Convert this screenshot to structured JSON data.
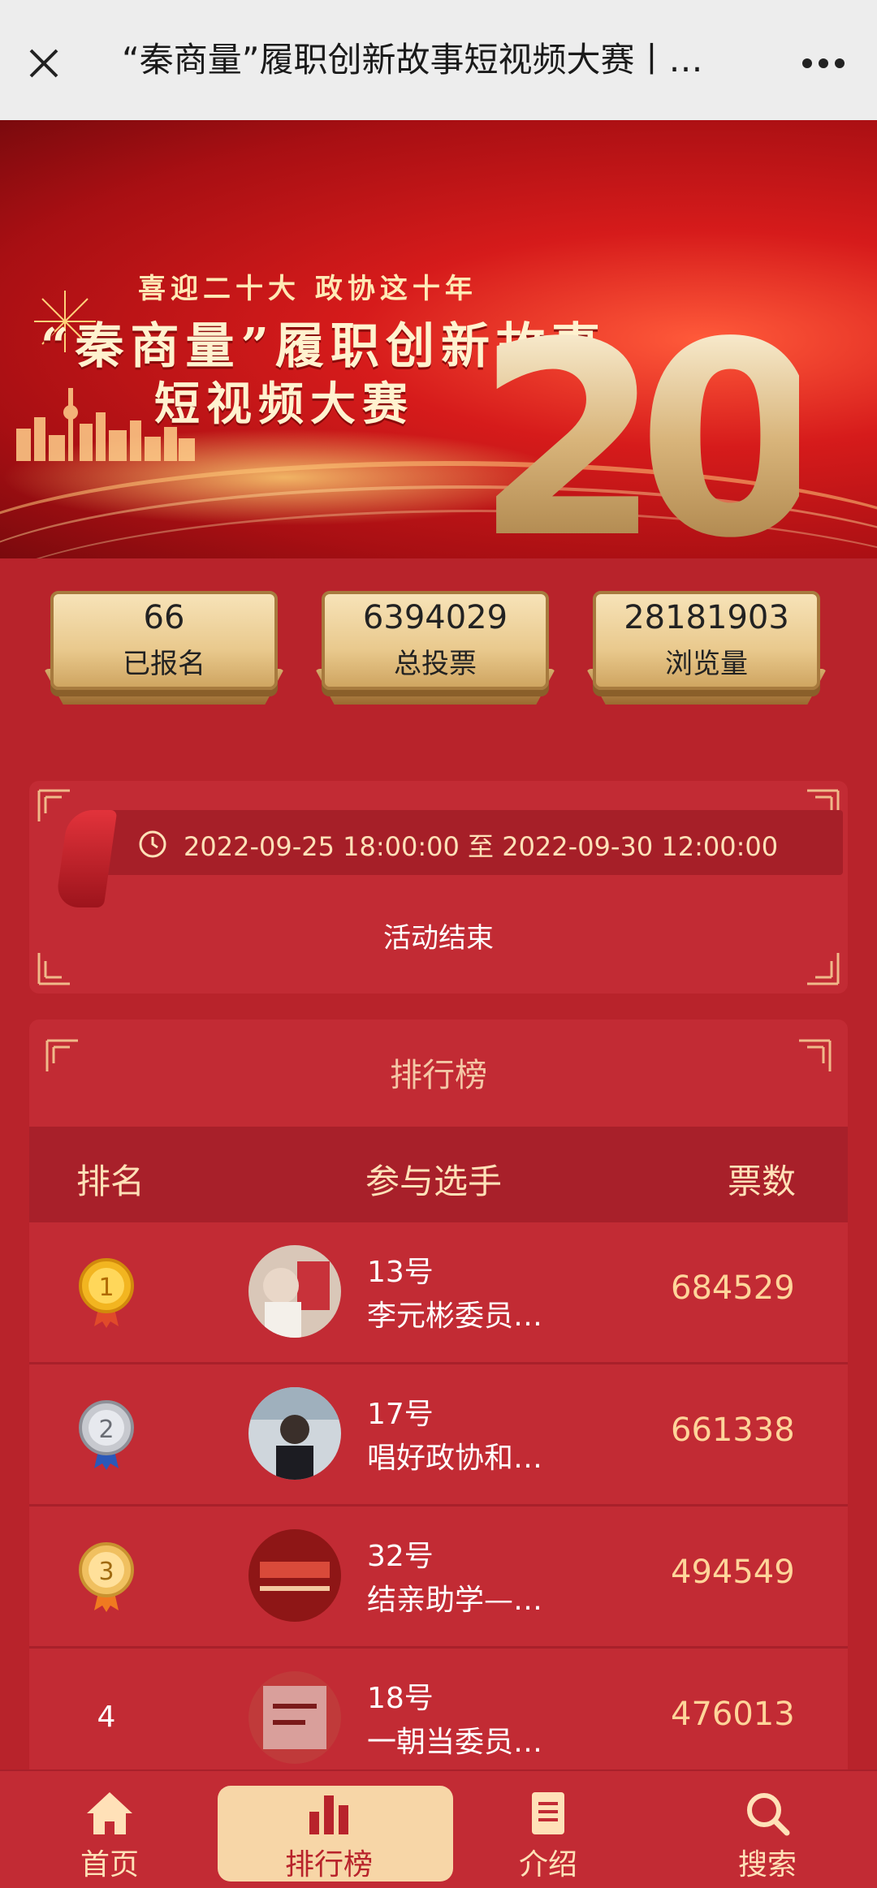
{
  "topbar": {
    "title": "“秦商量”履职创新故事短视频大赛丨…"
  },
  "banner": {
    "line1": "喜迎二十大 政协这十年",
    "line2": "“秦商量”履职创新故事",
    "line3": "短视频大赛",
    "big_number": "20"
  },
  "stats": [
    {
      "value": "66",
      "label": "已报名"
    },
    {
      "value": "6394029",
      "label": "总投票"
    },
    {
      "value": "28181903",
      "label": "浏览量"
    }
  ],
  "time_panel": {
    "range": "2022-09-25 18:00:00 至 2022-09-30 12:00:00",
    "status": "活动结束"
  },
  "ranking": {
    "title": "排行榜",
    "headers": {
      "rank": "排名",
      "player": "参与选手",
      "votes": "票数"
    },
    "rows": [
      {
        "rank": "1",
        "number": "13号",
        "name": "李元彬委员…",
        "votes": "684529",
        "medal": "gold"
      },
      {
        "rank": "2",
        "number": "17号",
        "name": "唱好政协和…",
        "votes": "661338",
        "medal": "silver"
      },
      {
        "rank": "3",
        "number": "32号",
        "name": "结亲助学—…",
        "votes": "494549",
        "medal": "bronze"
      },
      {
        "rank": "4",
        "number": "18号",
        "name": "一朝当委员…",
        "votes": "476013",
        "medal": "none"
      }
    ]
  },
  "bottom_nav": [
    {
      "label": "首页",
      "icon": "home-icon"
    },
    {
      "label": "排行榜",
      "icon": "bar-chart-icon",
      "active": true
    },
    {
      "label": "介绍",
      "icon": "document-icon"
    },
    {
      "label": "搜索",
      "icon": "search-icon"
    }
  ],
  "colors": {
    "background": "#b8232b",
    "panel": "#c22b34",
    "accent_gold": "#ffd59a",
    "active_tab": "#f7d6a7"
  }
}
